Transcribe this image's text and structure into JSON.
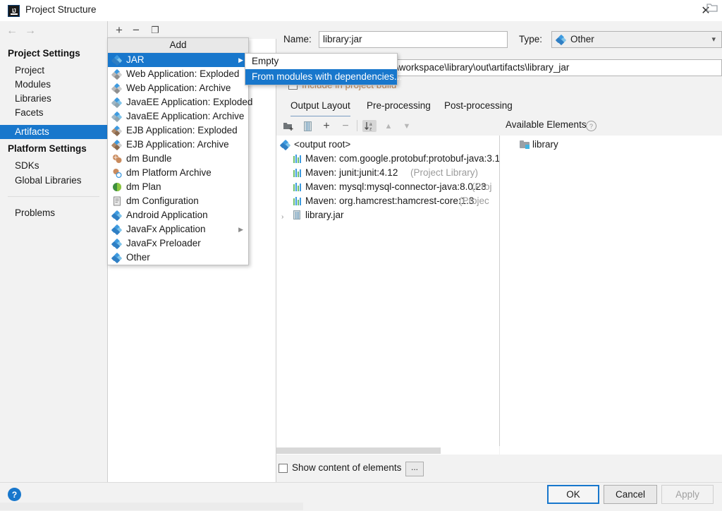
{
  "window": {
    "title": "Project Structure",
    "app_icon": "intellij-idea-icon",
    "close_label": "✕"
  },
  "nav": {
    "back": "←",
    "forward": "→"
  },
  "sidebar": {
    "groups": [
      {
        "label": "Project Settings",
        "items": [
          {
            "label": "Project",
            "selected": false
          },
          {
            "label": "Modules",
            "selected": false
          },
          {
            "label": "Libraries",
            "selected": false
          },
          {
            "label": "Facets",
            "selected": false
          },
          {
            "label": "Artifacts",
            "selected": true
          }
        ]
      },
      {
        "label": "Platform Settings",
        "items": [
          {
            "label": "SDKs",
            "selected": false
          },
          {
            "label": "Global Libraries",
            "selected": false
          }
        ]
      }
    ],
    "problems": {
      "label": "Problems"
    }
  },
  "artifact_toolbar": {
    "add": "+",
    "remove": "−",
    "copy": "❐"
  },
  "add_menu": {
    "header": "Add",
    "items": [
      {
        "label": "JAR",
        "icon": "diamond-icon",
        "selected": true,
        "has_submenu": true
      },
      {
        "label": "Web Application: Exploded",
        "icon": "web-icon",
        "selected": false,
        "has_submenu": false
      },
      {
        "label": "Web Application: Archive",
        "icon": "web-icon",
        "selected": false,
        "has_submenu": false
      },
      {
        "label": "JavaEE Application: Exploded",
        "icon": "javaee-icon",
        "selected": false,
        "has_submenu": false
      },
      {
        "label": "JavaEE Application: Archive",
        "icon": "javaee-icon",
        "selected": false,
        "has_submenu": false
      },
      {
        "label": "EJB Application: Exploded",
        "icon": "ejb-icon",
        "selected": false,
        "has_submenu": false
      },
      {
        "label": "EJB Application: Archive",
        "icon": "ejb-icon",
        "selected": false,
        "has_submenu": false
      },
      {
        "label": "dm Bundle",
        "icon": "dm-bundle-icon",
        "selected": false,
        "has_submenu": false
      },
      {
        "label": "dm Platform Archive",
        "icon": "dm-platform-icon",
        "selected": false,
        "has_submenu": false
      },
      {
        "label": "dm Plan",
        "icon": "dm-plan-icon",
        "selected": false,
        "has_submenu": false
      },
      {
        "label": "dm Configuration",
        "icon": "dm-config-icon",
        "selected": false,
        "has_submenu": false
      },
      {
        "label": "Android Application",
        "icon": "diamond-icon",
        "selected": false,
        "has_submenu": false
      },
      {
        "label": "JavaFx Application",
        "icon": "diamond-icon",
        "selected": false,
        "has_submenu": true
      },
      {
        "label": "JavaFx Preloader",
        "icon": "diamond-icon",
        "selected": false,
        "has_submenu": false
      },
      {
        "label": "Other",
        "icon": "diamond-icon",
        "selected": false,
        "has_submenu": false
      }
    ],
    "submenu": {
      "items": [
        {
          "label": "Empty",
          "selected": false
        },
        {
          "label": "From modules with dependencies...",
          "selected": true
        }
      ]
    }
  },
  "detail": {
    "name_label": "Name:",
    "name_value": "library:jar",
    "type_label": "Type:",
    "type_value": "Other",
    "type_icon": "diamond-icon",
    "output_directory_value": "\\workspace\\library\\out\\artifacts\\library_jar",
    "include_in_build_label": "Include in project build",
    "include_in_build_checked": false,
    "tabs": [
      {
        "label": "Output Layout",
        "active": true
      },
      {
        "label": "Pre-processing",
        "active": false
      },
      {
        "label": "Post-processing",
        "active": false
      }
    ],
    "layout_toolbar": {
      "add_folder": "add-folder-icon",
      "add_archive": "add-archive-icon",
      "add": "+",
      "remove": "−",
      "sort": "sort-az-icon",
      "move_up": "▲",
      "move_down": "▼"
    },
    "tree": [
      {
        "indent": 0,
        "icon": "diamond-icon",
        "label": "<output root>",
        "secondary": "",
        "expander": ""
      },
      {
        "indent": 1,
        "icon": "maven-library-icon",
        "label": "Maven: com.google.protobuf:protobuf-java:3.1",
        "secondary": "",
        "expander": ""
      },
      {
        "indent": 1,
        "icon": "maven-library-icon",
        "label": "Maven: junit:junit:4.12",
        "secondary": "(Project Library)",
        "expander": ""
      },
      {
        "indent": 1,
        "icon": "maven-library-icon",
        "label": "Maven: mysql:mysql-connector-java:8.0.23",
        "secondary": "(Proj",
        "expander": ""
      },
      {
        "indent": 1,
        "icon": "maven-library-icon",
        "label": "Maven: org.hamcrest:hamcrest-core:1.3",
        "secondary": "(Projec",
        "expander": ""
      },
      {
        "indent": 1,
        "icon": "jar-icon",
        "label": "library.jar",
        "secondary": "",
        "expander": "›"
      }
    ],
    "available_elements": {
      "title": "Available Elements",
      "help": "?",
      "items": [
        {
          "icon": "module-folder-icon",
          "label": "library"
        }
      ]
    },
    "show_content_label": "Show content of elements",
    "show_content_checked": false,
    "more_button": "..."
  },
  "footer": {
    "help": "?",
    "ok": "OK",
    "cancel": "Cancel",
    "apply": "Apply",
    "apply_disabled": true
  },
  "colors": {
    "accent": "#1877cc",
    "panel": "#f2f2f2",
    "selection_text": "#ffffff",
    "secondary_text": "#9b9b9b"
  }
}
